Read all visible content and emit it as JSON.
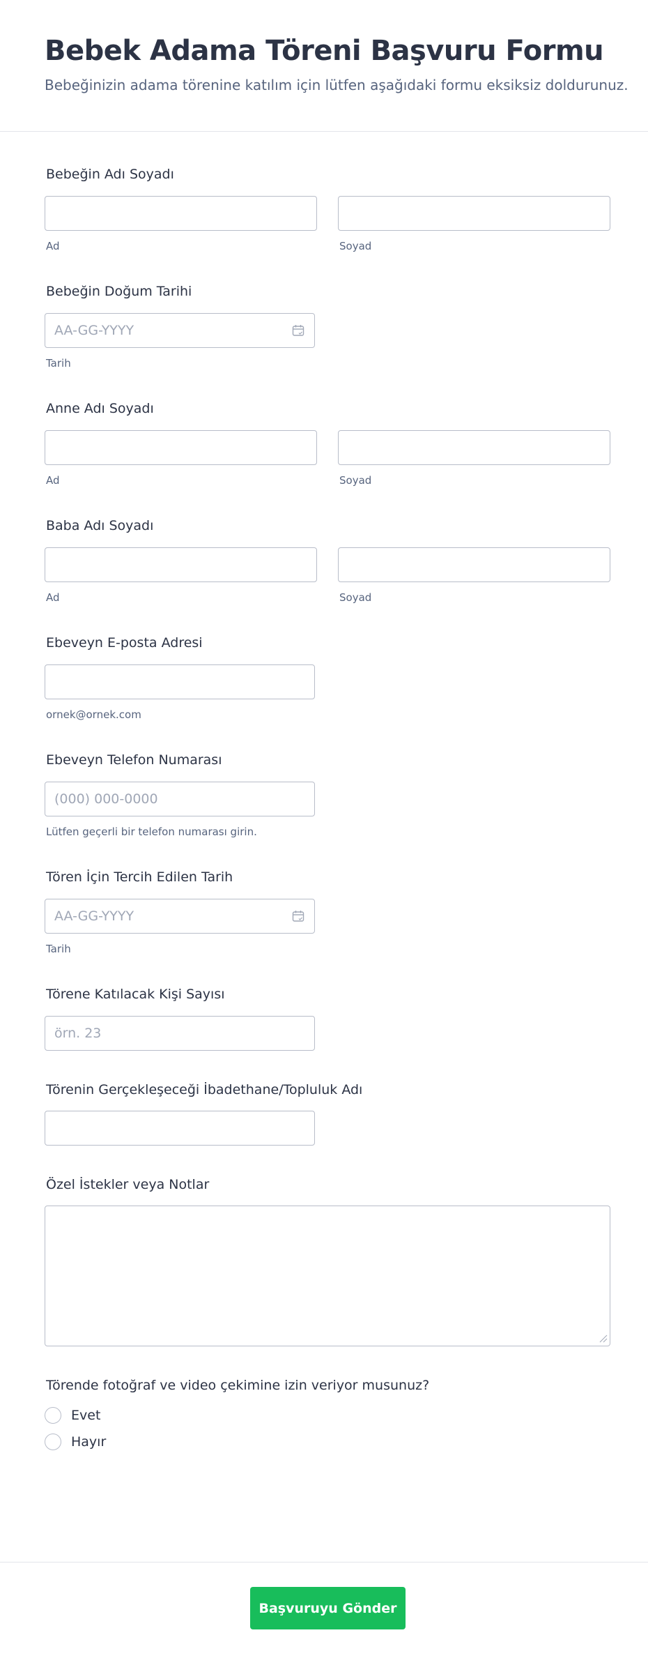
{
  "form": {
    "title": "Bebek Adama Töreni Başvuru Formu",
    "subtitle": "Bebeğinizin adama törenine katılım için lütfen aşağıdaki formu eksiksiz doldurunuz."
  },
  "baby_name": {
    "label": "Bebeğin Adı Soyadı",
    "first_sub": "Ad",
    "last_sub": "Soyad",
    "first_value": "",
    "last_value": ""
  },
  "baby_birth_date": {
    "label": "Bebeğin Doğum Tarihi",
    "placeholder": "AA-GG-YYYY",
    "sub": "Tarih",
    "icon": "calendar-icon"
  },
  "mother_name": {
    "label": "Anne Adı Soyadı",
    "first_sub": "Ad",
    "last_sub": "Soyad"
  },
  "father_name": {
    "label": "Baba Adı Soyadı",
    "first_sub": "Ad",
    "last_sub": "Soyad"
  },
  "parent_email": {
    "label": "Ebeveyn E-posta Adresi",
    "sub": "ornek@ornek.com"
  },
  "parent_phone": {
    "label": "Ebeveyn Telefon Numarası",
    "placeholder": "(000) 000-0000",
    "sub": "Lütfen geçerli bir telefon numarası girin."
  },
  "ceremony_date": {
    "label": "Tören İçin Tercih Edilen Tarih",
    "placeholder": "AA-GG-YYYY",
    "sub": "Tarih",
    "icon": "calendar-icon"
  },
  "attendee_count": {
    "label": "Törene Katılacak Kişi Sayısı",
    "placeholder": "örn. 23"
  },
  "venue_name": {
    "label": "Törenin Gerçekleşeceği İbadethane/Topluluk Adı"
  },
  "special_requests": {
    "label": "Özel İstekler veya Notlar"
  },
  "photo_consent": {
    "label": "Törende fotoğraf ve video çekimine izin veriyor musunuz?",
    "options": [
      "Evet",
      "Hayır"
    ],
    "selected": null
  },
  "submit": {
    "label": "Başvuruyu Gönder",
    "color": "#18bd5b"
  }
}
